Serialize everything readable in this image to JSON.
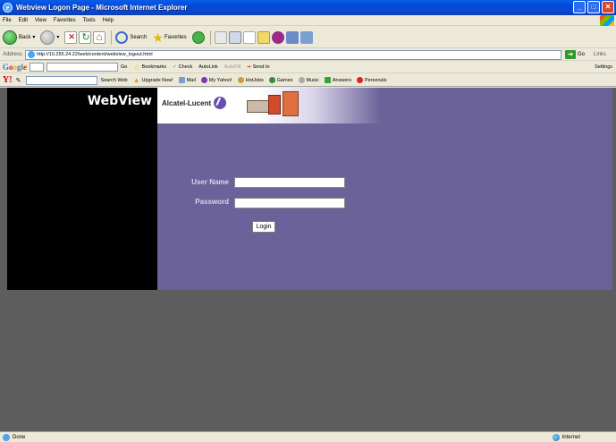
{
  "window": {
    "title": "Webview Logon Page - Microsoft Internet Explorer",
    "min": "_",
    "max": "□",
    "close": "✕"
  },
  "menu": [
    "File",
    "Edit",
    "View",
    "Favorites",
    "Tools",
    "Help"
  ],
  "toolbar": {
    "back": "Back",
    "search": "Search",
    "favorites": "Favorites"
  },
  "address": {
    "label": "Address",
    "url": "http://10.255.24.22/web/content/webview_logout.html",
    "go": "Go",
    "links": "Links"
  },
  "google": {
    "logo": "Google",
    "go": "Go",
    "bookmarks": "Bookmarks",
    "check": "Check",
    "autolink": "AutoLink",
    "autofill": "AutoFill",
    "sendto": "Send to",
    "settings": "Settings"
  },
  "yahoo": {
    "logo": "Y!",
    "search_web": "Search Web",
    "upgrade": "Upgrade Now!",
    "mail": "Mail",
    "my_yahoo": "My Yahoo!",
    "hotjobs": "HotJobs",
    "games": "Games",
    "music": "Music",
    "answers": "Answers",
    "personals": "Personals"
  },
  "page": {
    "app_title": "WebView",
    "brand": "Alcatel-Lucent",
    "username_label": "User Name",
    "password_label": "Password",
    "login_button": "Login",
    "username_value": "",
    "password_value": ""
  },
  "status": {
    "text": "Done",
    "zone": "Internet"
  }
}
